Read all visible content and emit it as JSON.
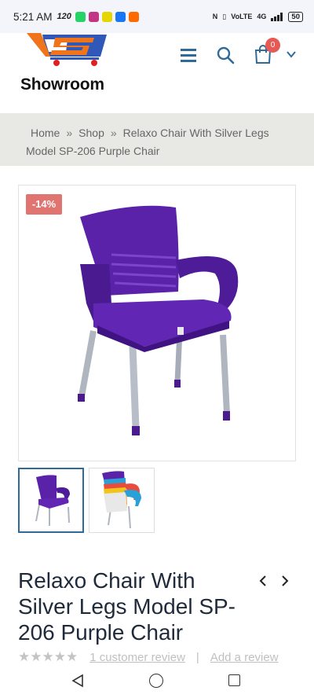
{
  "status_bar": {
    "time": "5:21 AM",
    "speed": "120",
    "volte_1": "VoLTE",
    "volte_2": "VoLTE",
    "network": "4G",
    "battery": "50",
    "notification_colors": [
      "#25d366",
      "#c13584",
      "#fffc00",
      "#1877f2",
      "#ff6a00"
    ]
  },
  "header": {
    "logo_text": "Showroom",
    "cart_count": "0",
    "icons": [
      "menu-icon",
      "search-icon",
      "cart-icon",
      "chevron-down-icon"
    ]
  },
  "breadcrumb": {
    "home": "Home",
    "separator": "»",
    "shop": "Shop",
    "current": "Relaxo Chair With Silver Legs Model SP-206 Purple Chair"
  },
  "gallery": {
    "sale_badge": "-14%",
    "thumbnails": [
      "Purple chair",
      "Stacked multicolor chairs"
    ]
  },
  "product": {
    "title": "Relaxo Chair With Silver Legs Model SP-206 Purple Chair",
    "stars": "★★★★★",
    "review_count_text": "1 customer review",
    "rating_separator": "|",
    "add_review_text": "Add a review"
  },
  "colors": {
    "brand_blue": "#2f6a98",
    "sale_red": "#e07470",
    "cart_badge": "#e65a55",
    "chair_purple": "#5a1fa8",
    "breadcrumb_bg": "#e8e8e4"
  }
}
